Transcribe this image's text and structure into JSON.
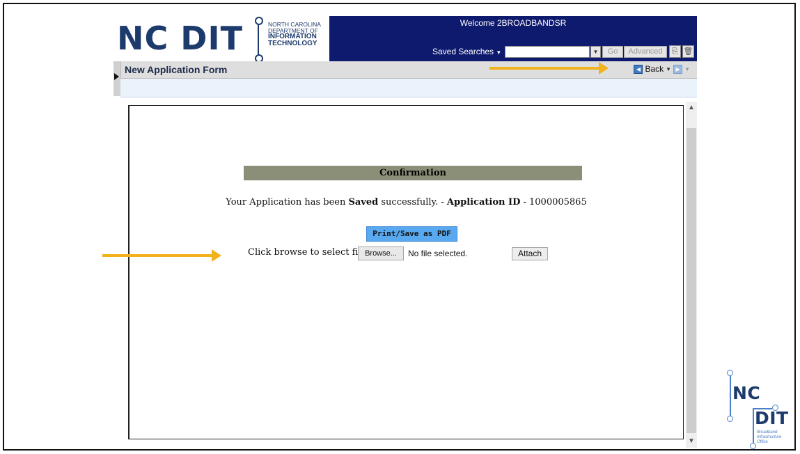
{
  "app": {
    "logo_text": "NC DIT",
    "logo_sub": [
      "NORTH CAROLINA",
      "DEPARTMENT OF",
      "INFORMATION",
      "TECHNOLOGY"
    ],
    "welcome": "Welcome 2BROADBANDSR",
    "saved_searches": "Saved Searches",
    "search_value": "",
    "go_label": "Go",
    "advanced_label": "Advanced",
    "page_title": "New Application Form",
    "back_label": "Back"
  },
  "confirmation": {
    "header": "Confirmation",
    "msg_part1": "Your Application has been ",
    "msg_saved": "Saved",
    "msg_part2": " successfully. - ",
    "msg_app_id_label": "Application ID",
    "msg_part3": " - 1000005865",
    "print_label": "Print/Save as PDF",
    "file_prompt": "Click browse to select file",
    "browse_label": "Browse...",
    "no_file": "No file selected.",
    "attach_label": "Attach"
  },
  "corner_logo": {
    "nc": "NC",
    "dit": "DIT",
    "sub": [
      "Broadband",
      "Infrastructure",
      "Office"
    ]
  },
  "colors": {
    "navy": "#0e1a6e",
    "logo_blue": "#1c3a6b",
    "arrow": "#f2b21b",
    "confirm_header": "#8c8f78",
    "print_button": "#59a9f0"
  },
  "icons": [
    "caret-down-icon",
    "dropdown-arrow-icon",
    "save-search-icon",
    "delete-search-icon",
    "back-arrow-icon",
    "forward-arrow-icon",
    "collapse-triangle-icon",
    "scroll-up-icon",
    "scroll-down-icon"
  ]
}
